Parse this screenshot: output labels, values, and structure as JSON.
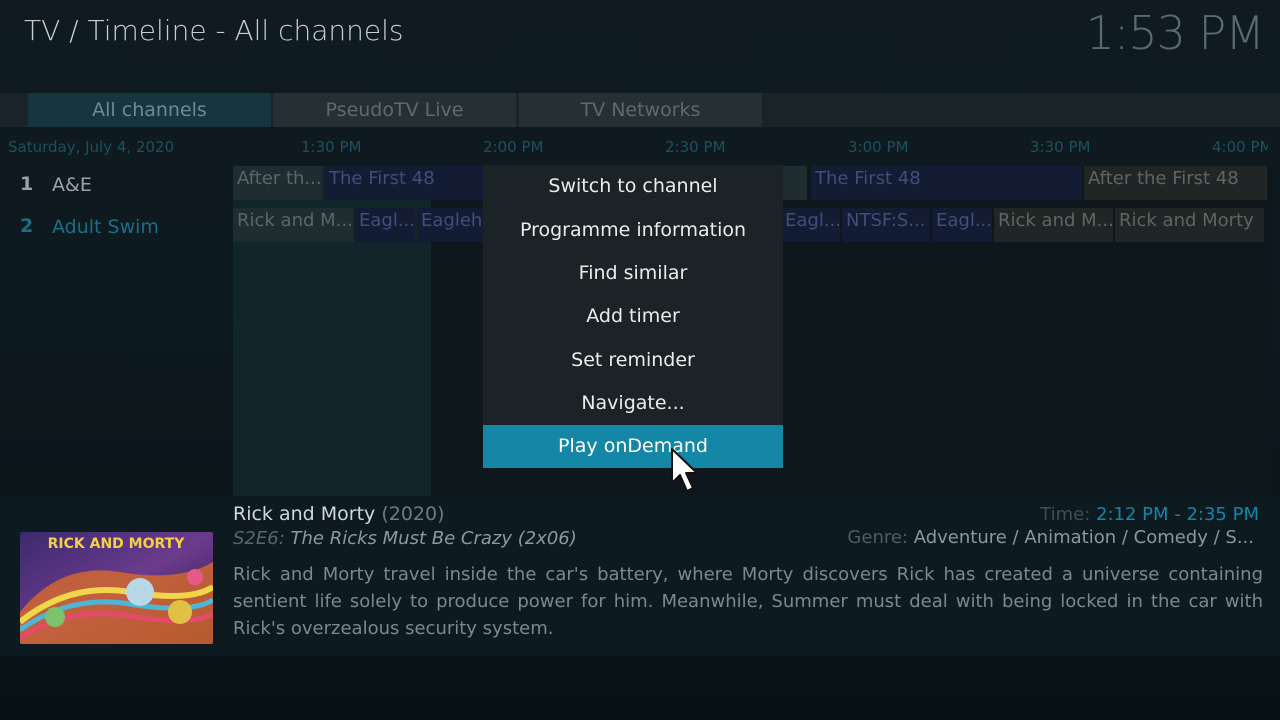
{
  "header": {
    "title": "TV / Timeline - All channels",
    "clock": "1:53 PM"
  },
  "tabs": [
    {
      "label": "All channels",
      "active": true
    },
    {
      "label": "PseudoTV Live",
      "active": false
    },
    {
      "label": "TV Networks",
      "active": false
    }
  ],
  "timeline": {
    "date": "Saturday, July 4, 2020",
    "times": [
      "1:30 PM",
      "2:00 PM",
      "2:30 PM",
      "3:00 PM",
      "3:30 PM",
      "4:00 PM"
    ]
  },
  "channels": [
    {
      "number": "1",
      "name": "A&E",
      "color": "#9aa3a7"
    },
    {
      "number": "2",
      "name": "Adult Swim",
      "color": "#1a6f86"
    }
  ],
  "programmes": {
    "row1": [
      "After th...",
      "The First 48",
      "The First 48",
      "After the First 48"
    ],
    "row2": [
      "Rick and M...",
      "Eagl...",
      "Eagleh",
      "Eagl...",
      "NTSF:S...",
      "Eagl...",
      "Rick and M...",
      "Rick and Morty"
    ]
  },
  "context_menu": {
    "items": [
      "Switch to channel",
      "Programme information",
      "Find similar",
      "Add timer",
      "Set reminder",
      "Navigate...",
      "Play onDemand"
    ],
    "focused_index": 6
  },
  "info": {
    "poster_text": "RICK AND MORTY",
    "title": "Rick and Morty",
    "year": "(2020)",
    "episode_code": "S2E6:",
    "episode_title": "The Ricks Must Be Crazy (2x06)",
    "time_label": "Time:",
    "time_value": "2:12 PM - 2:35 PM",
    "genre_label": "Genre:",
    "genre_value": "Adventure / Animation / Comedy / S...",
    "description": "Rick and Morty travel inside the car's battery, where Morty discovers Rick has created a universe containing sentient life solely to produce power for him. Meanwhile, Summer must deal with being locked in the car with Rick's overzealous security system."
  },
  "colors": {
    "accent": "#1486a6",
    "menu_bg": "#1c2326"
  }
}
